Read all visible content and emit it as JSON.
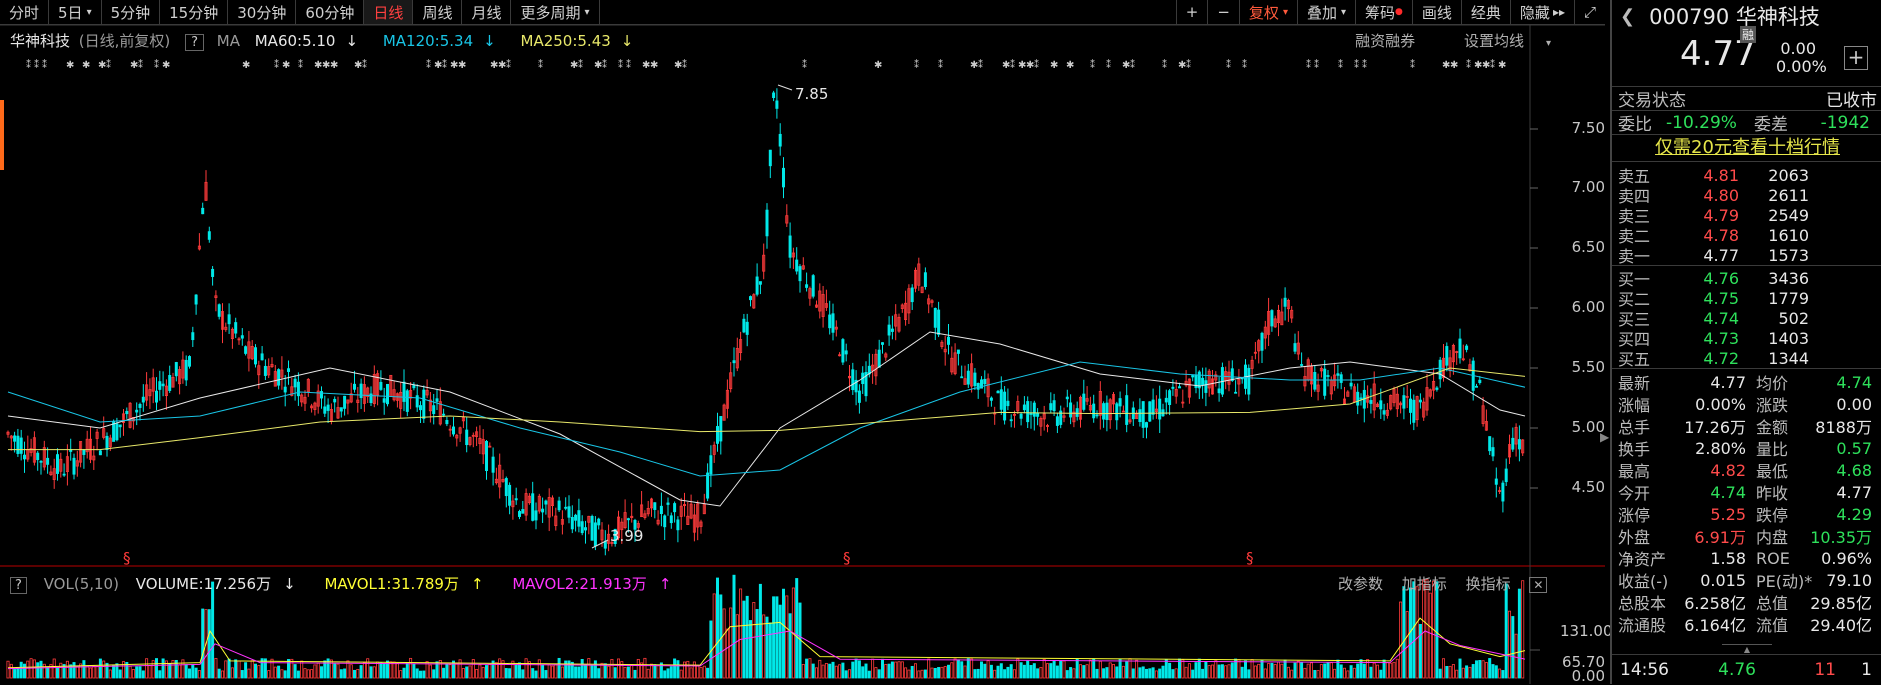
{
  "toolbar": {
    "periods": [
      {
        "label": "分时",
        "caret": false,
        "active": false
      },
      {
        "label": "5日",
        "caret": true,
        "active": false
      },
      {
        "label": "5分钟",
        "caret": false,
        "active": false
      },
      {
        "label": "15分钟",
        "caret": false,
        "active": false
      },
      {
        "label": "30分钟",
        "caret": false,
        "active": false
      },
      {
        "label": "60分钟",
        "caret": false,
        "active": false
      },
      {
        "label": "日线",
        "caret": false,
        "active": true
      },
      {
        "label": "周线",
        "caret": false,
        "active": false
      },
      {
        "label": "月线",
        "caret": false,
        "active": false
      },
      {
        "label": "更多周期",
        "caret": true,
        "active": false
      }
    ],
    "zoom_in": "+",
    "zoom_out": "−",
    "fuquan": "复权",
    "diejia": "叠加",
    "chouma": "筹码",
    "huaxian": "画线",
    "jingdian": "经典",
    "yincang": "隐藏",
    "yincang_arrows": "▸▸",
    "fullscreen": "⤢"
  },
  "legend": {
    "stock": "华神科技",
    "mode": "(日线,前复权)",
    "help": "?",
    "ma": "MA",
    "ma60": "MA60:5.10",
    "ma120": "MA120:5.34",
    "ma250": "MA250:5.43",
    "rongzi": "融资融券",
    "shezhi": "设置均线"
  },
  "colors": {
    "up": "#ff3b3b",
    "down": "#00e8e8",
    "ma60": "#e8e8e8",
    "ma120": "#19c5e6",
    "ma250": "#e8e86a",
    "mavol1": "#ffff33",
    "mavol2": "#ff33ff"
  },
  "price_axis": [
    "7.50",
    "7.00",
    "6.50",
    "6.00",
    "5.50",
    "5.00",
    "4.50"
  ],
  "annotations": {
    "high": "7.85",
    "low": "3.99",
    "s_mark": "§"
  },
  "vol_legend": {
    "help": "?",
    "name": "VOL(5,10)",
    "volume": "VOLUME:17.256万",
    "mavol1": "MAVOL1:31.789万",
    "mavol2": "MAVOL2:21.913万",
    "gaicanshu": "改参数",
    "jiazhibiao": "加指标",
    "huanzhibiao": "换指标"
  },
  "vol_axis": [
    "131.00",
    "65.70",
    "0.00"
  ],
  "chart_data": {
    "type": "candlestick",
    "title": "华神科技",
    "high_label": 7.85,
    "low_label": 3.99,
    "ylim": [
      3.9,
      8.0
    ],
    "ma60_last": 5.1,
    "ma120_last": 5.34,
    "ma250_last": 5.43,
    "volume_last": 17.256,
    "mavol1_last": 31.789,
    "mavol2_last": 21.913,
    "vol_ylim": [
      0,
      131.0
    ]
  },
  "panel": {
    "code_name": "000790 华神科技",
    "price": "4.77",
    "rong": "融",
    "change": "0.00",
    "change_pct": "0.00%",
    "plus": "+",
    "trade_status_label": "交易状态",
    "trade_status": "已收市",
    "weibi_label": "委比",
    "weibi": "-10.29%",
    "weicha_label": "委差",
    "weicha": "-1942",
    "promo": "仅需20元查看十档行情",
    "sells": [
      {
        "label": "卖五",
        "price": "4.81",
        "vol": "2063",
        "color": "red"
      },
      {
        "label": "卖四",
        "price": "4.80",
        "vol": "2611",
        "color": "red"
      },
      {
        "label": "卖三",
        "price": "4.79",
        "vol": "2549",
        "color": "red"
      },
      {
        "label": "卖二",
        "price": "4.78",
        "vol": "1610",
        "color": "red"
      },
      {
        "label": "卖一",
        "price": "4.77",
        "vol": "1573",
        "color": "white"
      }
    ],
    "buys": [
      {
        "label": "买一",
        "price": "4.76",
        "vol": "3436",
        "color": "green"
      },
      {
        "label": "买二",
        "price": "4.75",
        "vol": "1779",
        "color": "green"
      },
      {
        "label": "买三",
        "price": "4.74",
        "vol": "502",
        "color": "green"
      },
      {
        "label": "买四",
        "price": "4.73",
        "vol": "1403",
        "color": "green"
      },
      {
        "label": "买五",
        "price": "4.72",
        "vol": "1344",
        "color": "green"
      }
    ],
    "quotes": [
      {
        "k1": "最新",
        "v1": "4.77",
        "c1": "white",
        "k2": "均价",
        "v2": "4.74",
        "c2": "green"
      },
      {
        "k1": "涨幅",
        "v1": "0.00%",
        "c1": "white",
        "k2": "涨跌",
        "v2": "0.00",
        "c2": "white"
      },
      {
        "k1": "总手",
        "v1": "17.26万",
        "c1": "white",
        "k2": "金额",
        "v2": "8188万",
        "c2": "white"
      },
      {
        "k1": "换手",
        "v1": "2.80%",
        "c1": "white",
        "k2": "量比",
        "v2": "0.57",
        "c2": "green"
      },
      {
        "k1": "最高",
        "v1": "4.82",
        "c1": "red",
        "k2": "最低",
        "v2": "4.68",
        "c2": "green"
      },
      {
        "k1": "今开",
        "v1": "4.74",
        "c1": "green",
        "k2": "昨收",
        "v2": "4.77",
        "c2": "white"
      },
      {
        "k1": "涨停",
        "v1": "5.25",
        "c1": "red",
        "k2": "跌停",
        "v2": "4.29",
        "c2": "green"
      },
      {
        "k1": "外盘",
        "v1": "6.91万",
        "c1": "red",
        "k2": "内盘",
        "v2": "10.35万",
        "c2": "green"
      },
      {
        "k1": "净资产",
        "v1": "1.58",
        "c1": "white",
        "k2": "ROE",
        "v2": "0.96%",
        "c2": "white"
      },
      {
        "k1": "收益(-)",
        "v1": "0.015",
        "c1": "white",
        "k2": "PE(动)*",
        "v2": "79.10",
        "c2": "white"
      },
      {
        "k1": "总股本",
        "v1": "6.258亿",
        "c1": "white",
        "k2": "总值",
        "v2": "29.85亿",
        "c2": "white"
      },
      {
        "k1": "流通股",
        "v1": "6.164亿",
        "c1": "white",
        "k2": "流值",
        "v2": "29.40亿",
        "c2": "white"
      }
    ],
    "tick": {
      "time": "14:56",
      "price": "4.76",
      "vol": "11",
      "count": "1"
    }
  }
}
